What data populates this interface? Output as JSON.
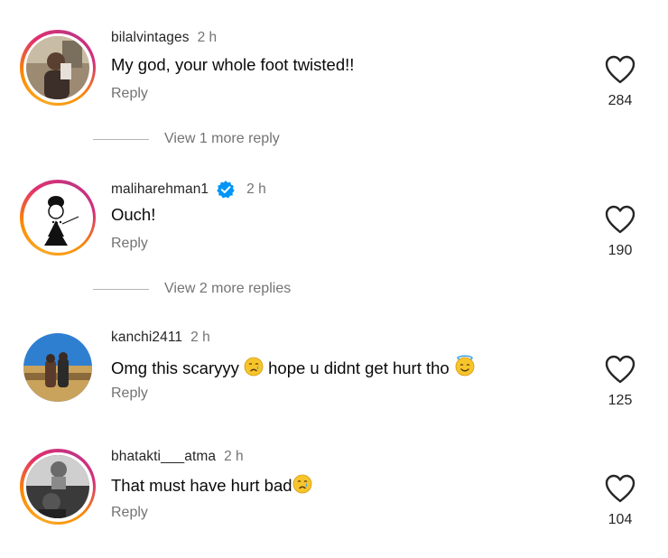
{
  "comments": [
    {
      "username": "bilalvintages",
      "time": "2 h",
      "text": "My god, your whole foot twisted!!",
      "reply_label": "Reply",
      "likes": "284",
      "more_replies": "View 1 more reply",
      "verified": false,
      "story_ring": true
    },
    {
      "username": "maliharehman1",
      "time": "2 h",
      "text": "Ouch!",
      "reply_label": "Reply",
      "likes": "190",
      "more_replies": "View 2 more replies",
      "verified": true,
      "story_ring": true
    },
    {
      "username": "kanchi2411",
      "time": "2 h",
      "text_before_emoji": "Omg this scaryyy ",
      "text_middle": " hope u didnt get hurt tho ",
      "emojis": [
        "crying-face",
        "smiling-face-with-halo"
      ],
      "reply_label": "Reply",
      "likes": "125",
      "verified": false,
      "story_ring": false
    },
    {
      "username": "bhatakti___atma",
      "time": "2 h",
      "text": "That must have hurt bad",
      "emojis": [
        "crying-face"
      ],
      "reply_label": "Reply",
      "likes": "104",
      "verified": false,
      "story_ring": true
    }
  ],
  "colors": {
    "username": "#262626",
    "secondary": "#737373",
    "verified_blue": "#0095f6"
  },
  "icons": [
    "heart-outline-icon",
    "verified-badge-icon",
    "crying-face-emoji",
    "halo-face-emoji"
  ]
}
